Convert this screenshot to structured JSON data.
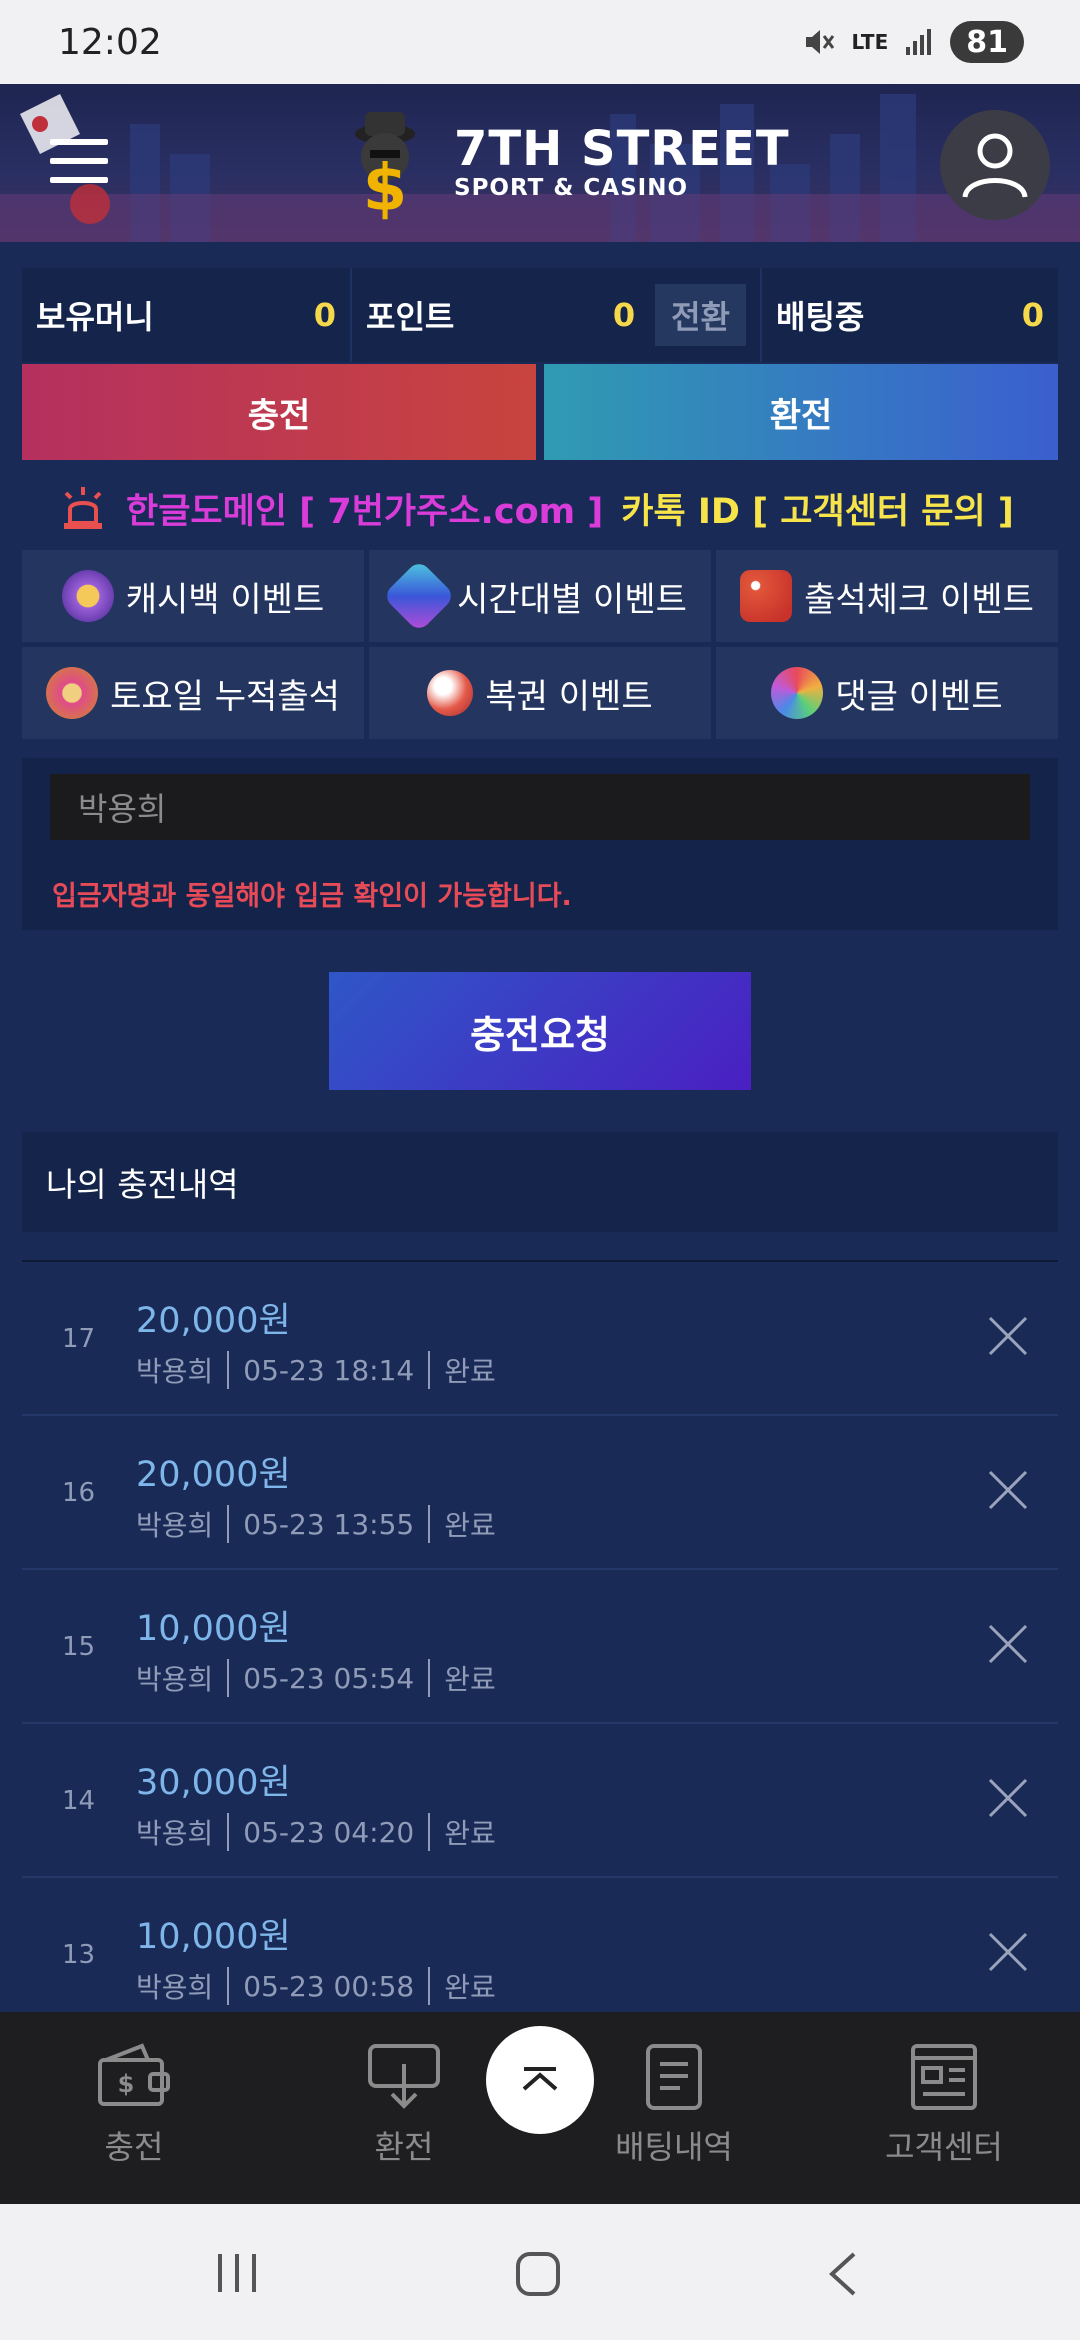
{
  "status_bar": {
    "time": "12:02",
    "network": "LTE",
    "battery": "81"
  },
  "header": {
    "brand_line1": "7TH STREET",
    "brand_line2": "SPORT & CASINO"
  },
  "balance": {
    "money_label": "보유머니",
    "money_value": "0",
    "point_label": "포인트",
    "point_value": "0",
    "convert_label": "전환",
    "betting_label": "배팅중",
    "betting_value": "0"
  },
  "actions": {
    "charge": "충전",
    "exchange": "환전"
  },
  "notice": {
    "pink_text": "한글도메인 [ 7번가주소.com ]",
    "yellow_text": "카톡 ID [ 고객센터 문의 ]"
  },
  "events": [
    {
      "label": "캐시백 이벤트",
      "icon": "coin-icon"
    },
    {
      "label": "시간대별 이벤트",
      "icon": "gem-icon"
    },
    {
      "label": "출석체크 이벤트",
      "icon": "dice-icon"
    },
    {
      "label": "토요일 누적출석",
      "icon": "chip-icon"
    },
    {
      "label": "복권 이벤트",
      "icon": "ball-icon"
    },
    {
      "label": "댓글 이벤트",
      "icon": "wheel-icon"
    }
  ],
  "deposit": {
    "name_value": "박용희",
    "warning": "입금자명과 동일해야 입금 확인이 가능합니다.",
    "request_button": "충전요청"
  },
  "history": {
    "title": "나의 충전내역",
    "items": [
      {
        "num": "17",
        "amount": "20,000원",
        "name": "박용희",
        "time": "05-23 18:14",
        "status": "완료"
      },
      {
        "num": "16",
        "amount": "20,000원",
        "name": "박용희",
        "time": "05-23 13:55",
        "status": "완료"
      },
      {
        "num": "15",
        "amount": "10,000원",
        "name": "박용희",
        "time": "05-23 05:54",
        "status": "완료"
      },
      {
        "num": "14",
        "amount": "30,000원",
        "name": "박용희",
        "time": "05-23 04:20",
        "status": "완료"
      },
      {
        "num": "13",
        "amount": "10,000원",
        "name": "박용희",
        "time": "05-23 00:58",
        "status": "완료"
      }
    ]
  },
  "bottom_nav": {
    "charge": "충전",
    "exchange": "환전",
    "bets": "배팅내역",
    "support": "고객센터"
  }
}
